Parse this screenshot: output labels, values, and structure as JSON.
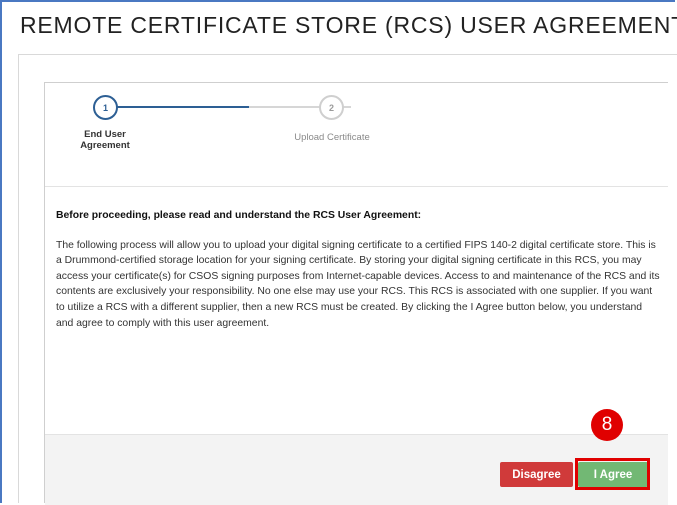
{
  "header": {
    "title": "REMOTE CERTIFICATE STORE (RCS) USER AGREEMENT"
  },
  "stepper": {
    "steps": [
      {
        "number": "1",
        "label": "End User Agreement",
        "state": "active"
      },
      {
        "number": "2",
        "label": "Upload Certificate",
        "state": "inactive"
      }
    ]
  },
  "agreement": {
    "heading": "Before proceeding, please read and understand the RCS User Agreement:",
    "body": "The following process will allow you to upload your digital signing certificate to a certified FIPS 140-2 digital certificate store. This is a Drummond-certified storage location for your signing certificate. By storing your digital signing certificate in this RCS, you may access your certificate(s) for CSOS signing purposes from Internet-capable devices. Access to and maintenance of the RCS and its contents are exclusively your responsibility. No one else may use your RCS. This RCS is associated with one supplier. If you want to utilize a RCS with a different supplier, then a new RCS must be created. By clicking the I Agree button below, you understand and agree to comply with this user agreement."
  },
  "footer": {
    "disagree_label": "Disagree",
    "agree_label": "I Agree"
  },
  "annotation": {
    "step_badge": "8"
  },
  "colors": {
    "active_step": "#2d5f94",
    "disagree": "#d03a3a",
    "agree": "#72b874",
    "highlight": "#e00000"
  }
}
